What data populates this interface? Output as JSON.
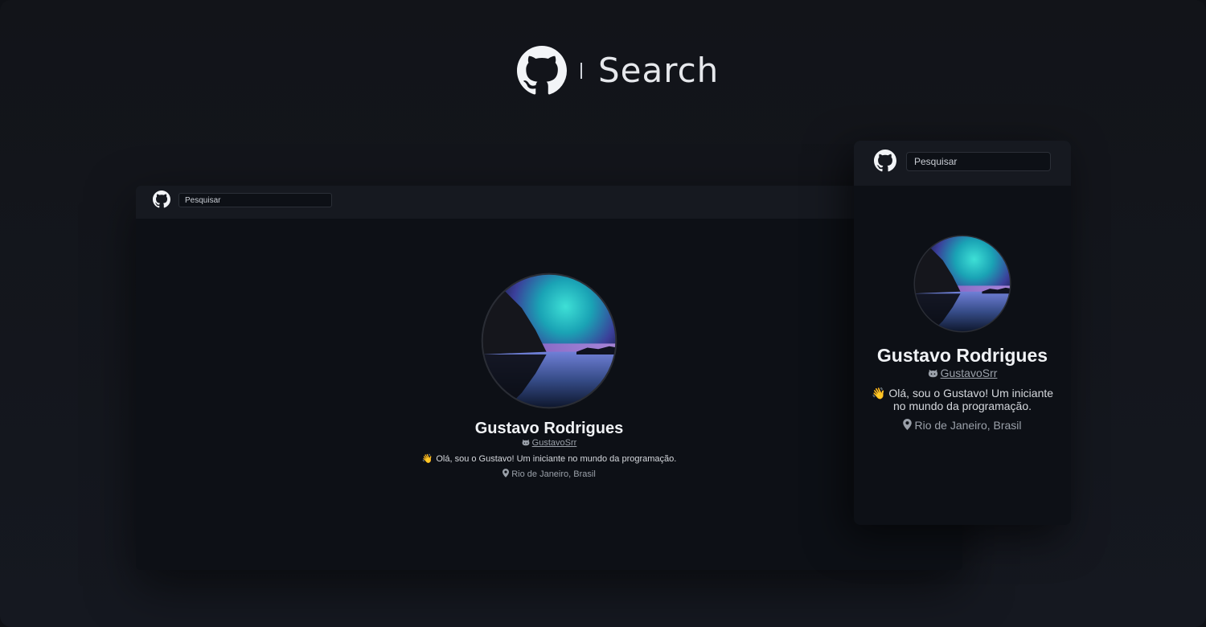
{
  "hero": {
    "logo_icon": "github-icon",
    "title": "Search"
  },
  "desktop": {
    "nav_logo_icon": "github-icon",
    "search_placeholder": "Pesquisar",
    "profile": {
      "name": "Gustavo Rodrigues",
      "login": "GustavoSrr",
      "login_icon": "octocat-icon",
      "bio_emoji": "👋",
      "bio": "Olá, sou o Gustavo! Um iniciante no mundo da programação.",
      "location_icon": "map-pin-icon",
      "location": "Rio de Janeiro, Brasil"
    }
  },
  "mobile": {
    "nav_logo_icon": "github-icon",
    "search_placeholder": "Pesquisar",
    "profile": {
      "name": "Gustavo Rodrigues",
      "login": "GustavoSrr",
      "login_icon": "octocat-icon",
      "bio_emoji": "👋",
      "bio": "Olá, sou o Gustavo! Um iniciante no mundo da programação.",
      "location_icon": "map-pin-icon",
      "location": "Rio de Janeiro, Brasil"
    }
  },
  "colors": {
    "background": "#121419",
    "panel": "#0d1016",
    "nav": "#161920",
    "text": "#f0f2f5",
    "muted": "#9aa0a9"
  }
}
